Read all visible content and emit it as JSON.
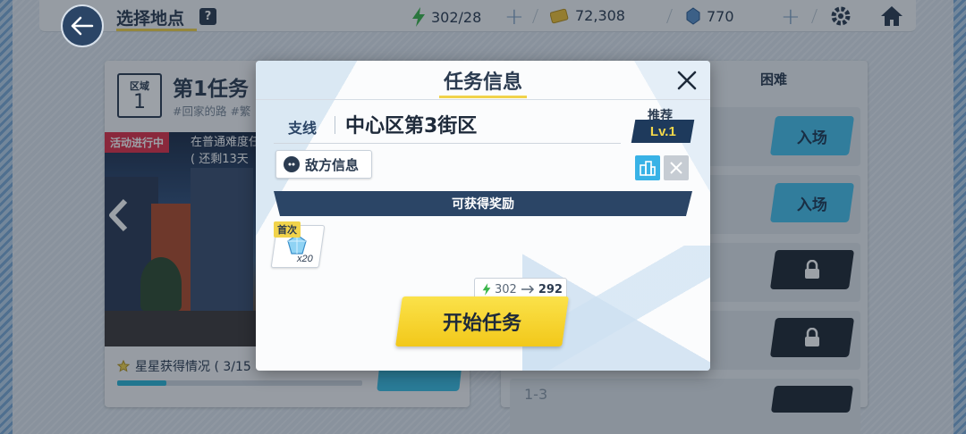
{
  "header": {
    "title": "选择地点",
    "help_label": "?",
    "stamina": "302/28",
    "credits": "72,308",
    "gems": "770",
    "plus_symbol": "+"
  },
  "left_card": {
    "area_label": "区域",
    "area_number": "1",
    "mission_name": "第1任务",
    "mission_tags": "#回家的路 #繁",
    "event_badge": "活动进行中",
    "event_line1": "在普通难度任",
    "event_line2": "( 还剩13天",
    "star_text": "星星获得情况 ( 3/15",
    "star_progress": 0.2
  },
  "right_panel": {
    "header": "困难",
    "rows": [
      {
        "state": "enter",
        "label": "入场"
      },
      {
        "state": "enter",
        "label": "入场"
      },
      {
        "state": "locked"
      },
      {
        "state": "locked"
      }
    ],
    "bottom_row_text": "1-3"
  },
  "modal": {
    "title": "任务信息",
    "branch": "支线",
    "location": "中心区第3街区",
    "recommend_label": "推荐",
    "recommend_level": "Lv.1",
    "enemy_info": "敌方信息",
    "rewards_header": "可获得奖励",
    "first_clear_badge": "首次",
    "reward_qty": "x20",
    "stamina_before": "302",
    "stamina_after": "292",
    "start_button": "开始任务"
  },
  "colors": {
    "navy": "#2b4566",
    "accent_yellow": "#f1d34b",
    "enter_blue": "#47c2ec",
    "event_red": "#e03048"
  }
}
